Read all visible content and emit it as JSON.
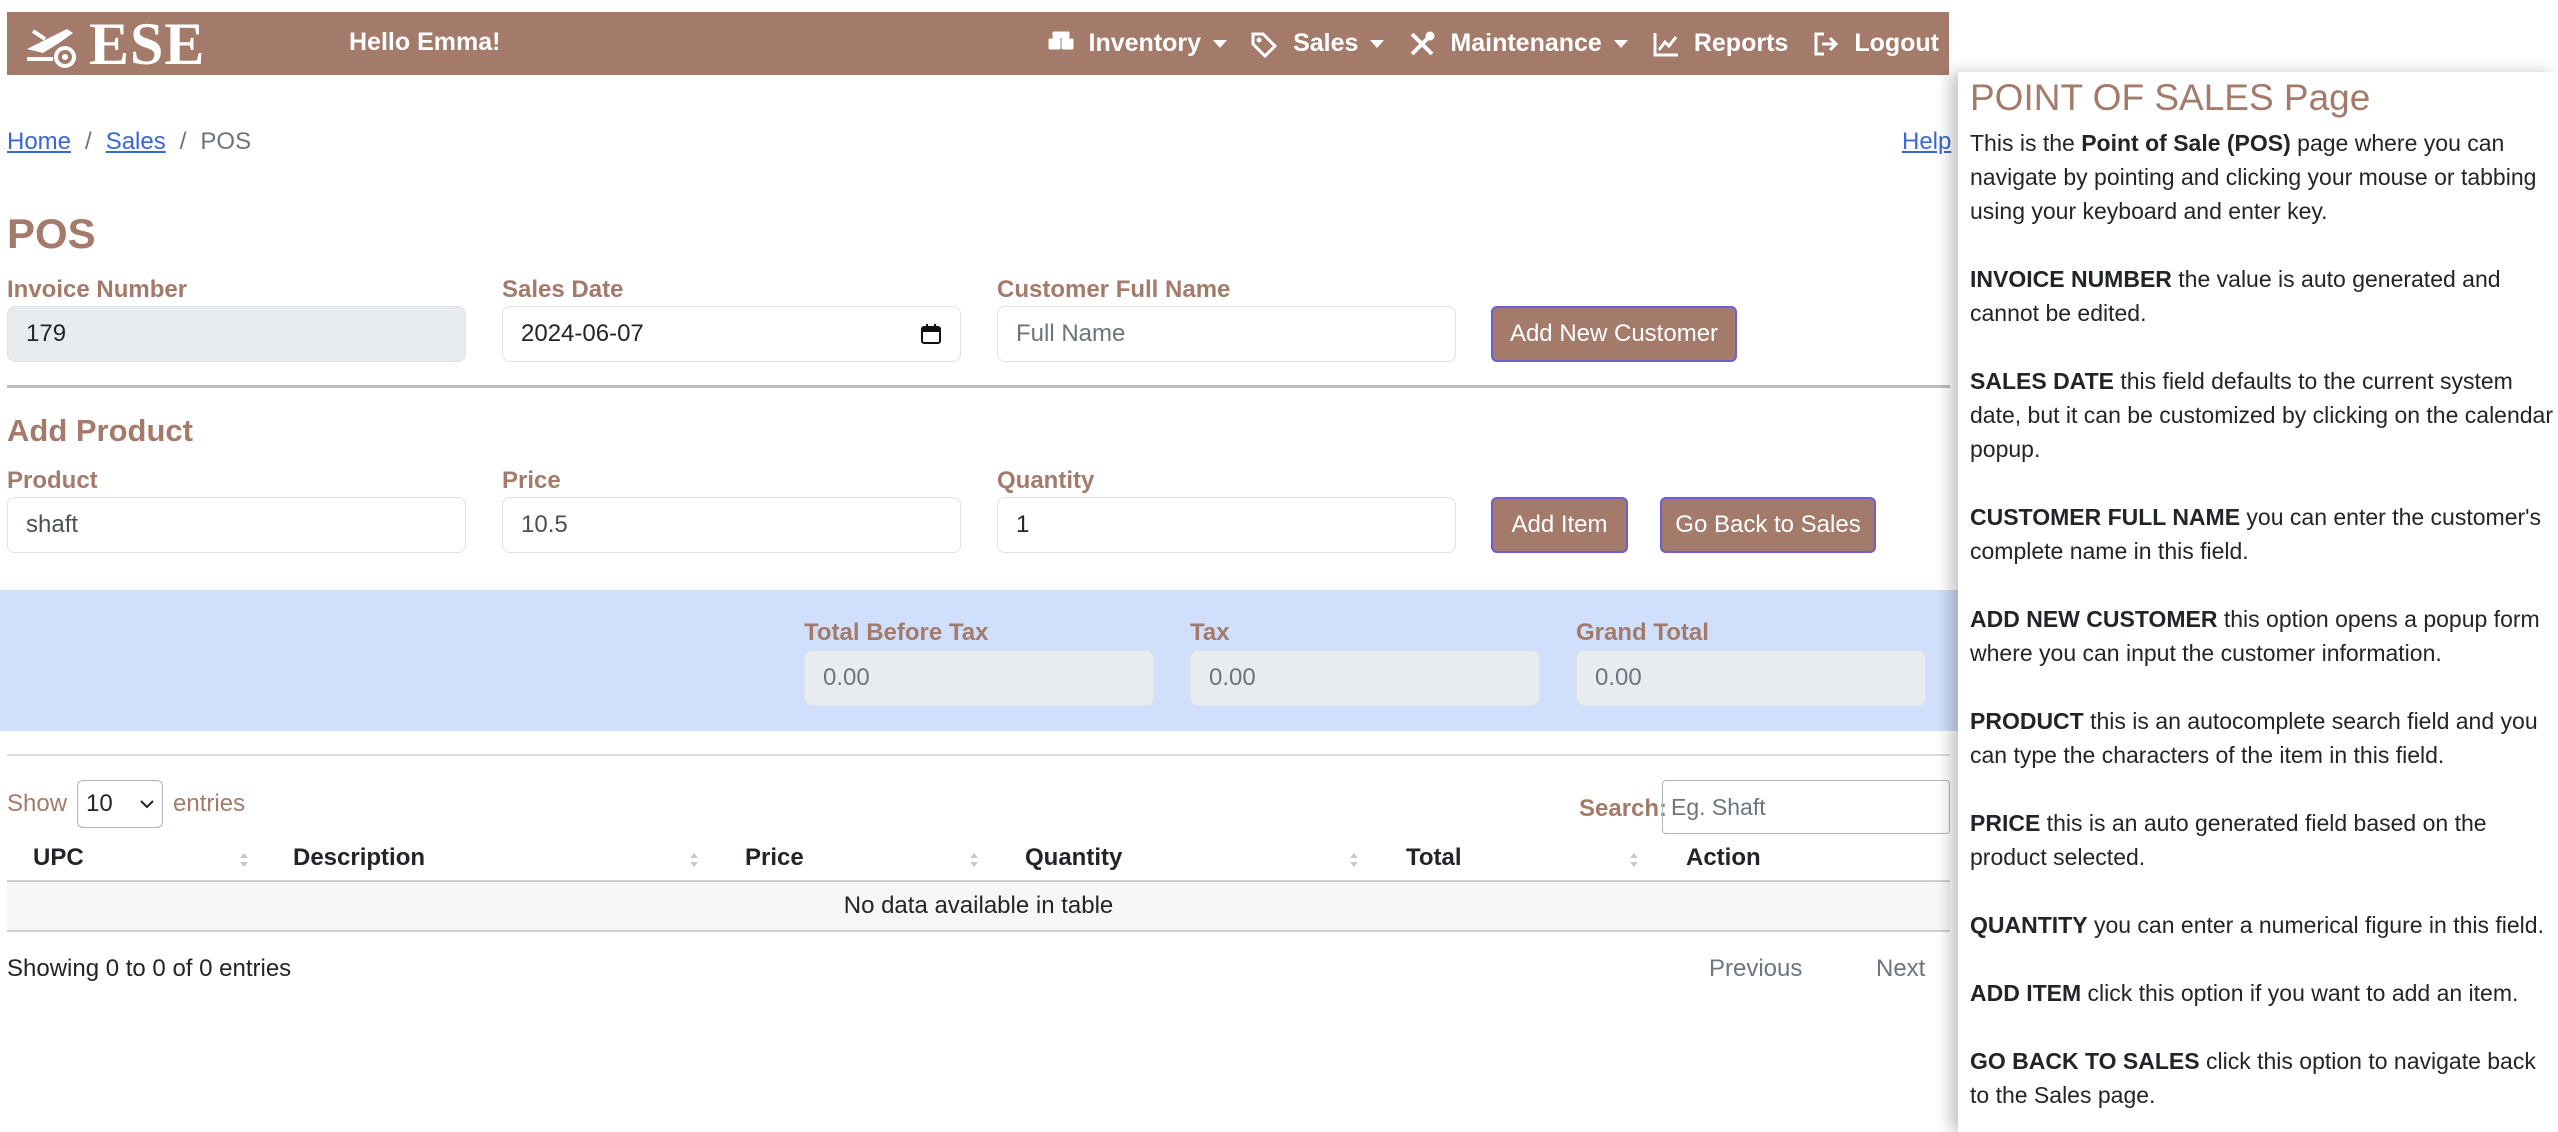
{
  "navbar": {
    "brand": "ESE",
    "greeting": "Hello Emma!",
    "items": [
      {
        "label": "Inventory",
        "icon": "boxes-icon",
        "dropdown": true
      },
      {
        "label": "Sales",
        "icon": "tags-icon",
        "dropdown": true
      },
      {
        "label": "Maintenance",
        "icon": "tools-icon",
        "dropdown": true
      },
      {
        "label": "Reports",
        "icon": "chart-line-icon",
        "dropdown": false
      },
      {
        "label": "Logout",
        "icon": "sign-out-icon",
        "dropdown": false
      }
    ]
  },
  "breadcrumb": {
    "home": "Home",
    "sales": "Sales",
    "current": "POS",
    "sep": "/"
  },
  "help_link": "Help",
  "page_title": "POS",
  "invoice": {
    "invoice_label": "Invoice Number",
    "invoice_value": "179",
    "date_label": "Sales Date",
    "date_value": "2024-06-07",
    "customer_label": "Customer Full Name",
    "customer_placeholder": "Full Name",
    "add_customer_button": "Add New Customer"
  },
  "add_product": {
    "title": "Add Product",
    "product_label": "Product",
    "product_value": "shaft",
    "price_label": "Price",
    "price_value": "10.5",
    "quantity_label": "Quantity",
    "quantity_value": "1",
    "add_item_button": "Add Item",
    "back_button": "Go Back to Sales"
  },
  "totals": {
    "before_tax_label": "Total Before Tax",
    "before_tax_value": "0.00",
    "tax_label": "Tax",
    "tax_value": "0.00",
    "grand_label": "Grand Total",
    "grand_value": "0.00"
  },
  "table": {
    "show_label": "Show",
    "entries_label": "entries",
    "page_size": "10",
    "search_label": "Search:",
    "search_placeholder": "Eg. Shaft",
    "columns": [
      "UPC",
      "Description",
      "Price",
      "Quantity",
      "Total",
      "Action"
    ],
    "empty_message": "No data available in table",
    "info": "Showing 0 to 0 of 0 entries",
    "prev": "Previous",
    "next": "Next"
  },
  "help_panel": {
    "title": "POINT OF SALES Page",
    "intro_pre": "This is the ",
    "intro_bold": "Point of Sale (POS)",
    "intro_post": " page where you can navigate by pointing and clicking your mouse or tabbing using your keyboard and enter key.",
    "entries": [
      {
        "term": "INVOICE NUMBER",
        "text": " the value is auto generated and cannot be edited."
      },
      {
        "term": "SALES DATE",
        "text": " this field defaults to the current system date, but it can be customized by clicking on the calendar popup."
      },
      {
        "term": "CUSTOMER FULL NAME",
        "text": " you can enter the customer's complete name in this field."
      },
      {
        "term": "ADD NEW CUSTOMER",
        "text": " this option opens a popup form where you can input the customer information."
      },
      {
        "term": "PRODUCT",
        "text": " this is an autocomplete search field and you can type the characters of the item in this field."
      },
      {
        "term": "PRICE",
        "text": " this is an auto generated field based on the product selected."
      },
      {
        "term": "QUANTITY",
        "text": " you can enter a numerical figure in this field."
      },
      {
        "term": "ADD ITEM",
        "text": " click this option if you want to add an item."
      },
      {
        "term": "GO BACK TO SALES",
        "text": " click this option to navigate back to the Sales page."
      }
    ]
  },
  "colors": {
    "brand": "#a47b6b",
    "totals_band": "#d0dffb",
    "link": "#3867d6"
  }
}
